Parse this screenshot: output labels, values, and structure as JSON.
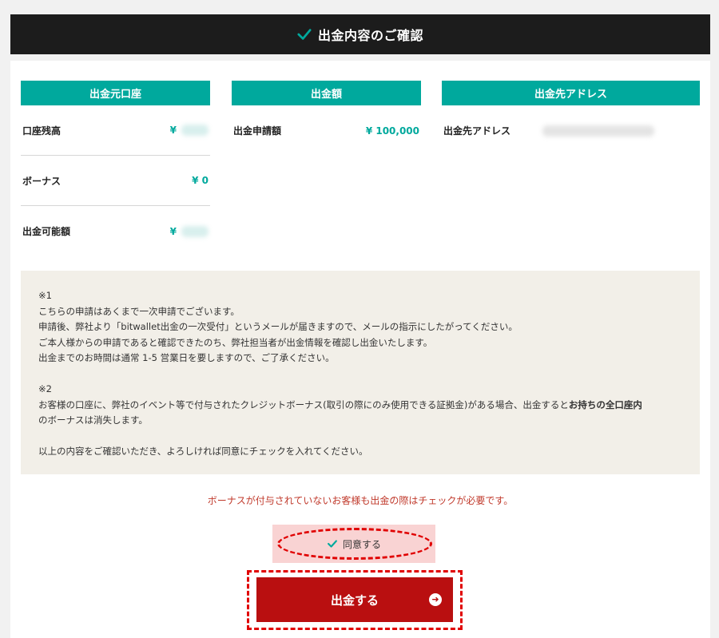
{
  "header": {
    "title": "出金内容のご確認"
  },
  "source": {
    "heading": "出金元口座",
    "rows": [
      {
        "label": "口座残高",
        "value": "¥"
      },
      {
        "label": "ボーナス",
        "value": "¥ 0"
      },
      {
        "label": "出金可能額",
        "value": "¥"
      }
    ]
  },
  "amount": {
    "heading": "出金額",
    "label": "出金申請額",
    "value": "¥ 100,000"
  },
  "destination": {
    "heading": "出金先アドレス",
    "label": "出金先アドレス"
  },
  "notice": {
    "note1_mark": "※1",
    "note1_lines": [
      "こちらの申請はあくまで一次申請でございます。",
      "申請後、弊社より「bitwallet出金の一次受付」というメールが届きますので、メールの指示にしたがってください。",
      "ご本人様からの申請であると確認できたのち、弊社担当者が出金情報を確認し出金いたします。",
      "出金までのお時間は通常 1-5 営業日を要しますので、ご了承ください。"
    ],
    "note2_mark": "※2",
    "note2_line1_a": "お客様の口座に、弊社のイベント等で付与されたクレジットボーナス(取引の際にのみ使用できる証拠金)がある場合、出金すると",
    "note2_line1_bold": "お持ちの全口座内",
    "note2_line2": "のボーナスは消失します。",
    "closing": "以上の内容をご確認いただき、よろしければ同意にチェックを入れてください。"
  },
  "warning": "ボーナスが付与されていないお客様も出金の際はチェックが必要です。",
  "agree": {
    "label": "同意する"
  },
  "submit": {
    "label": "出金する"
  },
  "colors": {
    "accent": "#00a99d",
    "header": "#1c1c1c",
    "submit": "#b90f10",
    "highlight": "#e00000"
  }
}
